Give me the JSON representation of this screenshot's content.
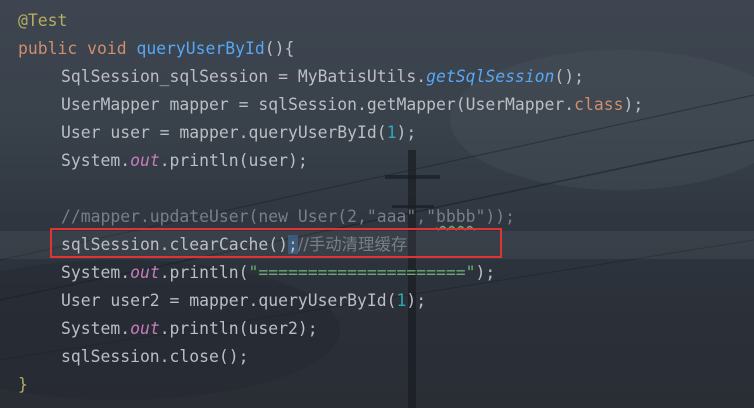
{
  "editor": {
    "annotation": "@Test",
    "method_decl": {
      "kw_public": "public",
      "kw_void": "void",
      "name": "queryUserById",
      "open": "(){"
    },
    "line3": {
      "decl": "SqlSession_sqlSession = MyBatisUtils.",
      "call": "getSqlSession",
      "end": "();"
    },
    "line4": {
      "a": "UserMapper mapper = sqlSession.getMapper(UserMapper.",
      "kw": "class",
      "b": ");"
    },
    "line5": {
      "a": "User user = mapper.queryUserById(",
      "num": "1",
      "b": ");"
    },
    "line6": {
      "a": "System.",
      "out": "out",
      "b": ".println(user);"
    },
    "line8": {
      "a": "//mapper.updateUser(new User(2,\"aaa\",\"",
      "typo": "bbbb",
      "b": "\"));"
    },
    "line9": {
      "a": "sqlSession.clearCache()",
      "semi": ";",
      "comment": "//手动清理缓存"
    },
    "line10": {
      "a": "System.",
      "out": "out",
      "b": ".println(",
      "str": "\"=====================\"",
      "c": ");"
    },
    "line11": {
      "a": "User user2 = mapper.queryUserById(",
      "num": "1",
      "b": ");"
    },
    "line12": {
      "a": "System.",
      "out": "out",
      "b": ".println(user2);"
    },
    "line13": {
      "text": "sqlSession.close();"
    },
    "closing_brace": "}"
  },
  "colors": {
    "keyword": "#cf8e6d",
    "function": "#56a8f5",
    "static_field": "#c77dbb",
    "number": "#2aacb8",
    "string": "#6aab73",
    "annotation": "#b3ae60",
    "comment": "#7a7e85",
    "highlight_box": "#e03434"
  }
}
